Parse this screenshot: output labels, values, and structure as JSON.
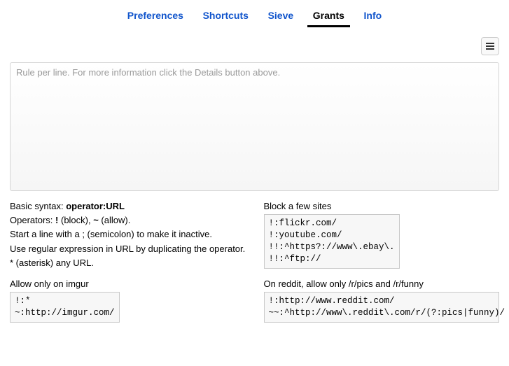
{
  "tabs": {
    "preferences": "Preferences",
    "shortcuts": "Shortcuts",
    "sieve": "Sieve",
    "grants": "Grants",
    "info": "Info"
  },
  "rules": {
    "placeholder": "Rule per line. For more information click the Details button above.",
    "value": ""
  },
  "help": {
    "syntax_label": "Basic syntax: ",
    "syntax_value": "operator:URL",
    "operators_line_a": "Operators: ",
    "op_block": "!",
    "op_block_suffix": " (block), ",
    "op_allow": "~",
    "op_allow_suffix": " (allow).",
    "semicolon": "Start a line with a ; (semicolon) to make it inactive.",
    "regex": "Use regular expression in URL by duplicating the operator.",
    "asterisk": "* (asterisk) any URL."
  },
  "ex_block": {
    "title": "Block a few sites",
    "code": "!:flickr.com/\n!:youtube.com/\n!!:^https?://www\\.ebay\\.\n!!:^ftp://"
  },
  "ex_imgur": {
    "title": "Allow only on imgur",
    "code": "!:*\n~:http://imgur.com/"
  },
  "ex_reddit": {
    "title": "On reddit, allow only /r/pics and /r/funny",
    "code": "!:http://www.reddit.com/\n~~:^http://www\\.reddit\\.com/r/(?:pics|funny)/"
  }
}
